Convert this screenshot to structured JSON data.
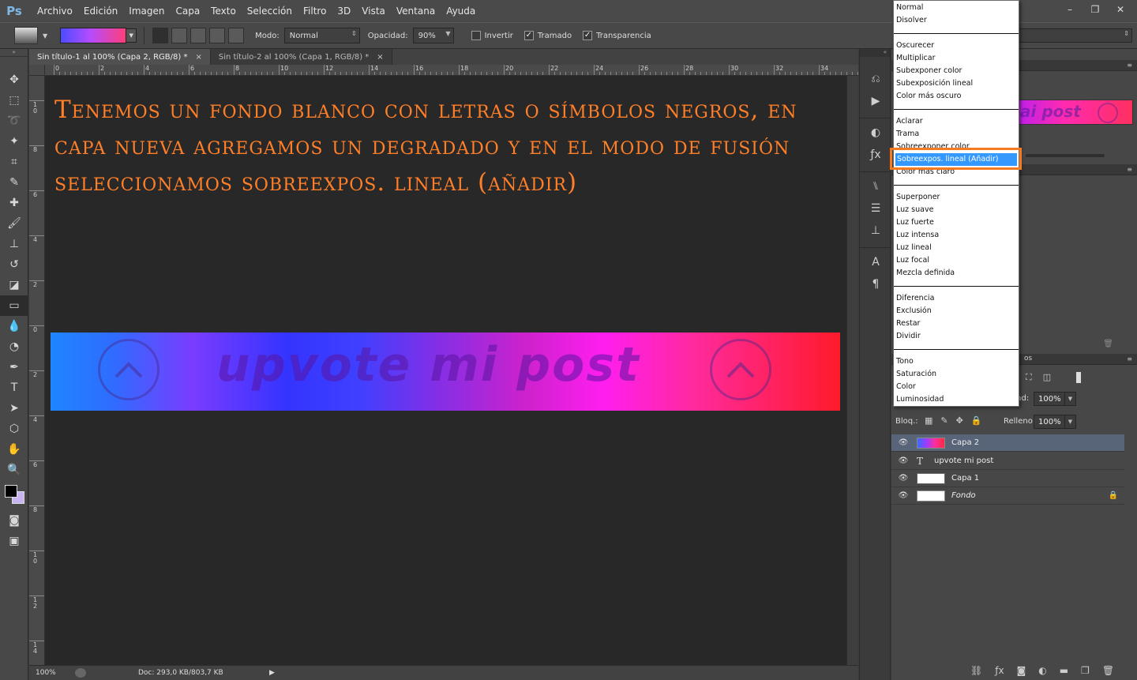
{
  "app": {
    "logo": "Ps"
  },
  "menu": [
    "Archivo",
    "Edición",
    "Imagen",
    "Capa",
    "Texto",
    "Selección",
    "Filtro",
    "3D",
    "Vista",
    "Ventana",
    "Ayuda"
  ],
  "window_controls": [
    "–",
    "❐",
    "✕"
  ],
  "options": {
    "mode_label": "Modo:",
    "mode_value": "Normal",
    "opacity_label": "Opacidad:",
    "opacity_value": "90%",
    "invert_label": "Invertir",
    "dither_label": "Tramado",
    "transparency_label": "Transparencia"
  },
  "tabs": [
    {
      "label": "Sin título-1 al 100% (Capa 2, RGB/8) *",
      "close": "×"
    },
    {
      "label": "Sin título-2 al 100% (Capa 1, RGB/8) *",
      "close": "×"
    }
  ],
  "ruler_top": [
    "0",
    "2",
    "4",
    "6",
    "8",
    "10",
    "12",
    "14",
    "16",
    "18",
    "20",
    "22",
    "24",
    "26",
    "28",
    "30",
    "32",
    "34"
  ],
  "ruler_left": [
    "0",
    "1 0",
    "8",
    "6",
    "4",
    "2",
    "0",
    "2",
    "4",
    "6",
    "8",
    "1 0",
    "1 2",
    "1 4"
  ],
  "canvas": {
    "instruction": "Tenemos un fondo blanco con letras o símbolos negros, en capa nueva agregamos un degradado y en el modo de fusión seleccionamos sobreexpos. lineal (añadir)",
    "banner_text": "upvote mi post"
  },
  "status": {
    "zoom": "100%",
    "doc": "Doc: 293,0 KB/803,7 KB"
  },
  "blend_modes": {
    "groups": [
      [
        "Normal",
        "Disolver"
      ],
      [
        "Oscurecer",
        "Multiplicar",
        "Subexponer color",
        "Subexposición lineal",
        "Color más oscuro"
      ],
      [
        "Aclarar",
        "Trama",
        "Sobreexponer color",
        "Sobreexpos. lineal (Añadir)",
        "Color más claro"
      ],
      [
        "Superponer",
        "Luz suave",
        "Luz fuerte",
        "Luz intensa",
        "Luz lineal",
        "Luz focal",
        "Mezcla definida"
      ],
      [
        "Diferencia",
        "Exclusión",
        "Restar",
        "Dividir"
      ],
      [
        "Tono",
        "Saturación",
        "Color",
        "Luminosidad"
      ]
    ],
    "selected": "Sobreexpos. lineal (Añadir)"
  },
  "preview": {
    "text": "ai post"
  },
  "layers_panel": {
    "tab_partial": "os",
    "opacity_label": "dad:",
    "opacity_value": "100%",
    "lock_label": "Bloq.:",
    "fill_label": "Relleno:",
    "fill_value": "100%",
    "layers": [
      {
        "name": "Capa 2",
        "type": "gradient",
        "selected": true
      },
      {
        "name": "upvote mi post",
        "type": "text",
        "selected": false
      },
      {
        "name": "Capa 1",
        "type": "pixel",
        "selected": false
      },
      {
        "name": "Fondo",
        "type": "background",
        "selected": false,
        "locked": true
      }
    ]
  }
}
